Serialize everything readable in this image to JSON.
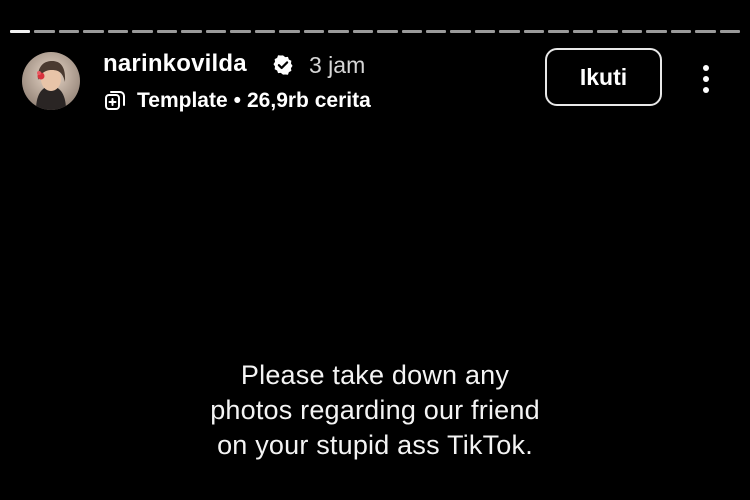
{
  "progress": {
    "segments": 30,
    "active_index": 0
  },
  "header": {
    "username": "narinkovilda",
    "verified_icon": "verified-badge-icon",
    "time_ago": "3 jam",
    "template_icon": "template-icon",
    "template_label": "Template",
    "separator": "•",
    "stories_count": "26,9rb cerita",
    "follow_label": "Ikuti",
    "more_icon": "more-vertical-icon"
  },
  "story": {
    "lines": [
      "Please take down any",
      "photos regarding our friend",
      "on your stupid ass TikTok."
    ]
  },
  "colors": {
    "background": "#000000",
    "text": "#ffffff",
    "muted": "#d6d6d6",
    "progress_inactive": "#9a9a9a"
  }
}
